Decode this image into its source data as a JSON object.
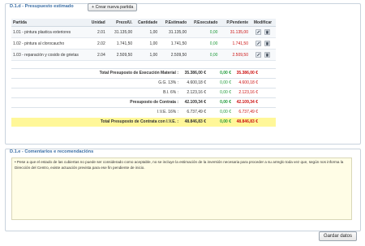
{
  "section1": {
    "legend": "D.1.d - Presupuesto estimado",
    "new_button": "+ Crear nueva partida"
  },
  "table": {
    "headers": [
      "Partida",
      "Unidad",
      "Prezo/U.",
      "Cantidade",
      "P.Estimado",
      "P.Executado",
      "P.Pendente",
      "Modificar"
    ],
    "rows": [
      {
        "partida": "1.01 - pintura plastica exteriores",
        "unidad": "2.01",
        "prezo": "31.135,00",
        "cantidade": "1,00",
        "estimado": "31.135,00",
        "executado": "0,00",
        "pendente": "31.135,00"
      },
      {
        "partida": "1.02 - pintura al clorocaucho",
        "unidad": "2.02",
        "prezo": "1.741,50",
        "cantidade": "1,00",
        "estimado": "1.741,50",
        "executado": "0,00",
        "pendente": "1.741,50"
      },
      {
        "partida": "1.03 - reparación y cosido de grietas",
        "unidad": "2.04",
        "prezo": "2.509,50",
        "cantidade": "1,00",
        "estimado": "2.509,50",
        "executado": "0,00",
        "pendente": "2.509,50"
      }
    ]
  },
  "totals": {
    "material": {
      "label": "Total Presuposto de Execución Material :",
      "estimado": "35.386,00 €",
      "executado": "0,00 €",
      "pendente": "35.386,00 €"
    },
    "gg": {
      "label": "G.G. 13% :",
      "estimado": "4.600,18 €",
      "executado": "0,00 €",
      "pendente": "4.600,18 €"
    },
    "bi": {
      "label": "B.I. 6% :",
      "estimado": "2.123,16 €",
      "executado": "0,00 €",
      "pendente": "2.123,16 €"
    },
    "contrata": {
      "label": "Presuposto de Contrata :",
      "estimado": "42.109,34 €",
      "executado": "0,00 €",
      "pendente": "42.109,34 €"
    },
    "ive": {
      "label": "I.V.E. 16% :",
      "estimado": "6.737,49 €",
      "executado": "0,00 €",
      "pendente": "6.737,49 €"
    },
    "total_ive": {
      "label": "Total Presuposto de Contrata con I.V.E. :",
      "estimado": "48.846,83 €",
      "executado": "0,00 €",
      "pendente": "48.846,83 €"
    }
  },
  "section2": {
    "legend": "D.1.e - Comentarios e recomendacións",
    "notes": "• Pese a que el estado de las cubiertas no puede ser considerado como aceptable, no se incluye la estimación de la inversión necesaria para proceder a su arreglo toda vez que, según nos informa la Dirección del Centro, existe actuación prevista para ese fin pendiente de inicio."
  },
  "save_button": "Gardar datos",
  "colors": {
    "accent": "#3a6ea5",
    "green": "#1f9a3a",
    "red": "#cc1111",
    "highlight": "#fff799"
  },
  "icons": [
    "edit-icon",
    "delete-icon"
  ]
}
